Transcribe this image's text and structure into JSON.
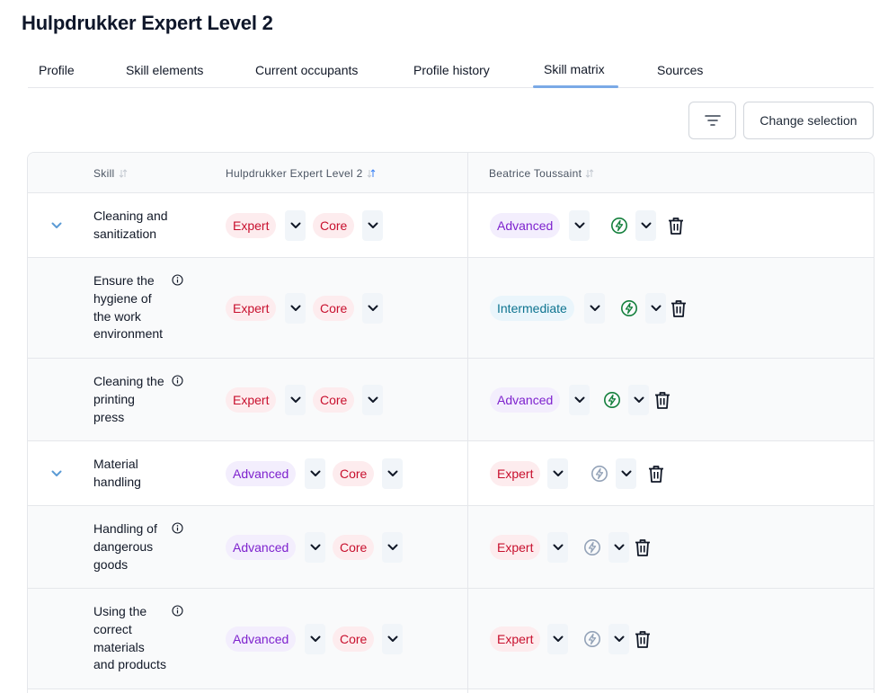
{
  "page": {
    "title": "Hulpdrukker Expert Level 2"
  },
  "tabs": [
    {
      "label": "Profile"
    },
    {
      "label": "Skill elements"
    },
    {
      "label": "Current occupants"
    },
    {
      "label": "Profile history"
    },
    {
      "label": "Skill matrix",
      "active": true
    },
    {
      "label": "Sources"
    }
  ],
  "toolbar": {
    "change_selection_label": "Change selection",
    "filter_icon": "filter-icon"
  },
  "table": {
    "headers": {
      "skill": "Skill",
      "profile": "Hulpdrukker Expert Level 2",
      "person": "Beatrice Toussaint"
    },
    "rows": [
      {
        "type": "parent",
        "name_lines": [
          "Cleaning and",
          "sanitization"
        ],
        "profile_level": "Expert",
        "profile_importance": "Core",
        "person_level": "Advanced",
        "bolt_active": true
      },
      {
        "type": "child",
        "name_lines": [
          "Ensure the",
          "hygiene of",
          "the work",
          "environment"
        ],
        "profile_level": "Expert",
        "profile_importance": "Core",
        "person_level": "Intermediate",
        "bolt_active": true
      },
      {
        "type": "child",
        "name_lines": [
          "Cleaning the",
          "printing",
          "press"
        ],
        "profile_level": "Expert",
        "profile_importance": "Core",
        "person_level": "Advanced",
        "bolt_active": true
      },
      {
        "type": "parent",
        "name_lines": [
          "Material",
          "handling"
        ],
        "profile_level": "Advanced",
        "profile_importance": "Core",
        "person_level": "Expert",
        "bolt_active": false
      },
      {
        "type": "child",
        "name_lines": [
          "Handling of",
          "dangerous",
          "goods"
        ],
        "profile_level": "Advanced",
        "profile_importance": "Core",
        "person_level": "Expert",
        "bolt_active": false
      },
      {
        "type": "child",
        "name_lines": [
          "Using the",
          "correct",
          "materials",
          "and products"
        ],
        "profile_level": "Advanced",
        "profile_importance": "Core",
        "person_level": "Expert",
        "bolt_active": false
      }
    ]
  },
  "colors": {
    "expert_text": "#c8102e",
    "expert_bg": "#fdecee",
    "advanced_text": "#7e22ce",
    "advanced_bg": "#f3eefd",
    "intermediate_text": "#0e7490",
    "intermediate_bg": "#eaf5fb",
    "bolt_active": "#15803d",
    "bolt_inactive": "#94a3b8",
    "tab_underline": "#7aa9e6"
  }
}
